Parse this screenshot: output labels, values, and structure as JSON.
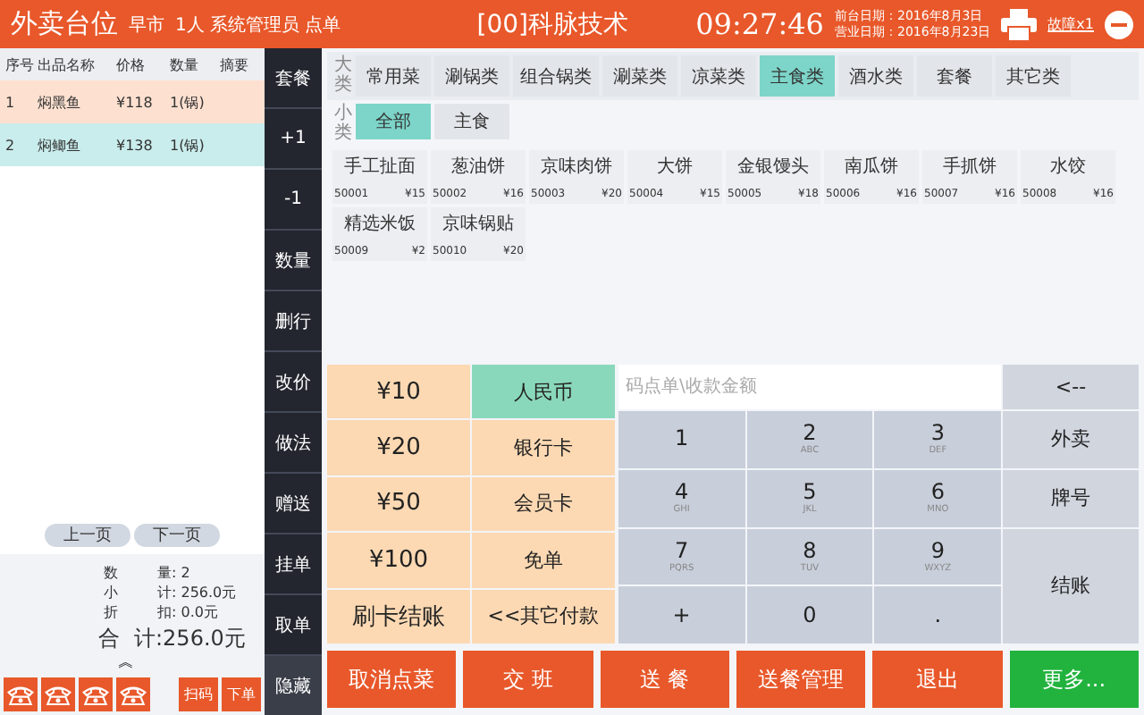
{
  "header": {
    "title": "外卖台位",
    "shift": "早市",
    "info": "1人 系统管理员 点单",
    "company": "[00]科脉技术",
    "time": "09:27:46",
    "dates": [
      "前台日期：2016年8月3日",
      "营业日期：2016年8月23日"
    ],
    "printer_status": "故障x1"
  },
  "order": {
    "columns": [
      "序号",
      "出品名称",
      "价格",
      "数量",
      "摘要"
    ],
    "rows": [
      {
        "cells": [
          "1",
          "焖黑鱼",
          "¥118",
          "1(锅)"
        ],
        "selected": true
      },
      {
        "cells": [
          "2",
          "焖鲫鱼",
          "¥138",
          "1(锅)"
        ],
        "selected": false
      }
    ],
    "pager": [
      "上一页",
      "下一页"
    ],
    "summary": [
      {
        "label": "数",
        "label2": "量",
        "value": ": 2"
      },
      {
        "label": "小",
        "label2": "计",
        "value": ": 256.0元"
      },
      {
        "label": "折",
        "label2": "扣",
        "value": ": 0.0元"
      }
    ],
    "total": {
      "label": "合",
      "label2": "计",
      "value": ":256.0元"
    },
    "expand": "︽",
    "actions": [
      "扫码",
      "下单"
    ]
  },
  "side_actions": [
    "套餐",
    "+1",
    "-1",
    "数量",
    "删行",
    "改价",
    "做法",
    "赠送",
    "挂单",
    "取单",
    "隐藏"
  ],
  "categories": {
    "label": "大类",
    "tabs": [
      {
        "label": "常用菜",
        "selected": false
      },
      {
        "label": "涮锅类",
        "selected": false
      },
      {
        "label": "组合锅类",
        "selected": false
      },
      {
        "label": "涮菜类",
        "selected": false
      },
      {
        "label": "凉菜类",
        "selected": false
      },
      {
        "label": "主食类",
        "selected": true
      },
      {
        "label": "酒水类",
        "selected": false
      },
      {
        "label": "套餐",
        "selected": false
      },
      {
        "label": "其它类",
        "selected": false
      }
    ]
  },
  "subcategories": {
    "label": "小类",
    "tabs": [
      {
        "label": "全部",
        "selected": true
      },
      {
        "label": "主食",
        "selected": false
      }
    ]
  },
  "dishes": [
    {
      "name": "手工扯面",
      "code": "50001",
      "price": "¥15"
    },
    {
      "name": "葱油饼",
      "code": "50002",
      "price": "¥16"
    },
    {
      "name": "京味肉饼",
      "code": "50003",
      "price": "¥20"
    },
    {
      "name": "大饼",
      "code": "50004",
      "price": "¥15"
    },
    {
      "name": "金银馒头",
      "code": "50005",
      "price": "¥18"
    },
    {
      "name": "南瓜饼",
      "code": "50006",
      "price": "¥16"
    },
    {
      "name": "手抓饼",
      "code": "50007",
      "price": "¥16"
    },
    {
      "name": "水饺",
      "code": "50008",
      "price": "¥16"
    },
    {
      "name": "精选米饭",
      "code": "50009",
      "price": "¥2"
    },
    {
      "name": "京味锅贴",
      "code": "50010",
      "price": "¥20"
    }
  ],
  "payment": {
    "amounts": [
      "¥10",
      "¥20",
      "¥50",
      "¥100",
      "刷卡结账"
    ],
    "methods": [
      {
        "label": "人民币",
        "selected": true
      },
      {
        "label": "银行卡",
        "selected": false
      },
      {
        "label": "会员卡",
        "selected": false
      },
      {
        "label": "免单",
        "selected": false
      },
      {
        "label": "<<其它付款",
        "selected": false
      }
    ],
    "input": {
      "placeholder": "码点单\\收款金额"
    },
    "keys": [
      {
        "digit": "1"
      },
      {
        "digit": "2",
        "letters": "ABC"
      },
      {
        "digit": "3",
        "letters": "DEF"
      },
      {
        "digit": "4",
        "letters": "GHI"
      },
      {
        "digit": "5",
        "letters": "JKL"
      },
      {
        "digit": "6",
        "letters": "MNO"
      },
      {
        "digit": "7",
        "letters": "PQRS"
      },
      {
        "digit": "8",
        "letters": "TUV"
      },
      {
        "digit": "9",
        "letters": "WXYZ"
      },
      {
        "digit": "+"
      },
      {
        "digit": "0"
      },
      {
        "digit": "."
      }
    ],
    "side_keys": [
      "<--",
      "外卖",
      "牌号",
      "结账"
    ]
  },
  "bottom_buttons": [
    {
      "label": "取消点菜",
      "kind": "danger"
    },
    {
      "label": "交 班",
      "kind": "danger"
    },
    {
      "label": "送 餐",
      "kind": "danger"
    },
    {
      "label": "送餐管理",
      "kind": "danger"
    },
    {
      "label": "退出",
      "kind": "danger"
    },
    {
      "label": "更多...",
      "kind": "success"
    }
  ]
}
